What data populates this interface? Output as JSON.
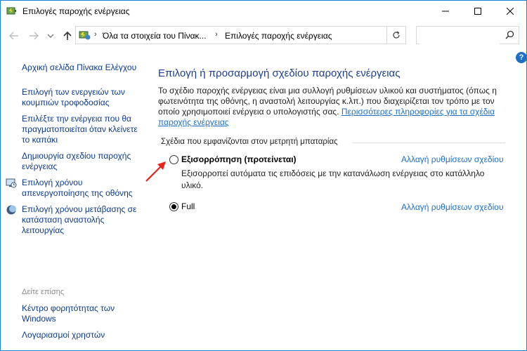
{
  "window": {
    "title": "Επιλογές παροχής ενέργειας",
    "icons": {
      "app": "power-options-icon",
      "minimize": "minimize-icon",
      "maximize": "maximize-icon",
      "close": "close-icon"
    }
  },
  "navigation": {
    "breadcrumbs": [
      "Όλα τα στοιχεία του Πίνακ...",
      "Επιλογές παροχής ενέργειας"
    ],
    "search": {
      "placeholder": "",
      "value": ""
    }
  },
  "sidebar": {
    "items": [
      {
        "label": "Αρχική σελίδα Πίνακα Ελέγχου",
        "icon": null
      },
      {
        "label": "Επιλογή των ενεργειών των κουμπιών τροφοδοσίας",
        "icon": null
      },
      {
        "label": "Επιλέξτε την ενέργεια που θα πραγματοποιείται όταν κλείνετε το καπάκι",
        "icon": null
      },
      {
        "label": "Δημιουργία σχεδίου παροχής ενέργειας",
        "icon": null
      },
      {
        "label": "Επιλογή χρόνου απενεργοποίησης της οθόνης",
        "icon": "display-timer-icon"
      },
      {
        "label": "Επιλογή χρόνου μετάβασης σε κατάσταση αναστολής λειτουργίας",
        "icon": "sleep-moon-icon"
      }
    ],
    "see_also_label": "Δείτε επίσης",
    "see_also": [
      {
        "label": "Κέντρο φορητότητας των Windows"
      },
      {
        "label": "Λογαριασμοί χρηστών"
      }
    ]
  },
  "main": {
    "title": "Επιλογή ή προσαρμογή σχεδίου παροχής ενέργειας",
    "description": "Το σχέδιο παροχής ενέργειας είναι μια συλλογή ρυθμίσεων υλικού και συστήματος (όπως η φωτεινότητα της οθόνης, η αναστολή λειτουργίας κ.λπ.) που διαχειρίζεται τον τρόπο με τον οποίο χρησιμοποιεί ενέργεια ο υπολογιστής σας.",
    "more_info_link": "Περισσότερες πληροφορίες για τα σχέδια παροχής ενέργειας",
    "section_label": "Σχέδια που εμφανίζονται στον μετρητή μπαταρίας",
    "plans": [
      {
        "name": "Εξισορρόπηση (προτείνεται)",
        "description": "Εξισορροπεί αυτόματα τις επιδόσεις με την κατανάλωση ενέργειας στο κατάλληλο υλικό.",
        "selected": false,
        "change_link": "Αλλαγή ρυθμίσεων σχεδίου"
      },
      {
        "name": "Full",
        "description": "",
        "selected": true,
        "change_link": "Αλλαγή ρυθμίσεων σχεδίου"
      }
    ]
  },
  "colors": {
    "link": "#1e6fc6",
    "nav_link": "#0c3a8b",
    "title": "#1d3f8f",
    "annotation": "#e8231e",
    "border": "#1883d7"
  }
}
